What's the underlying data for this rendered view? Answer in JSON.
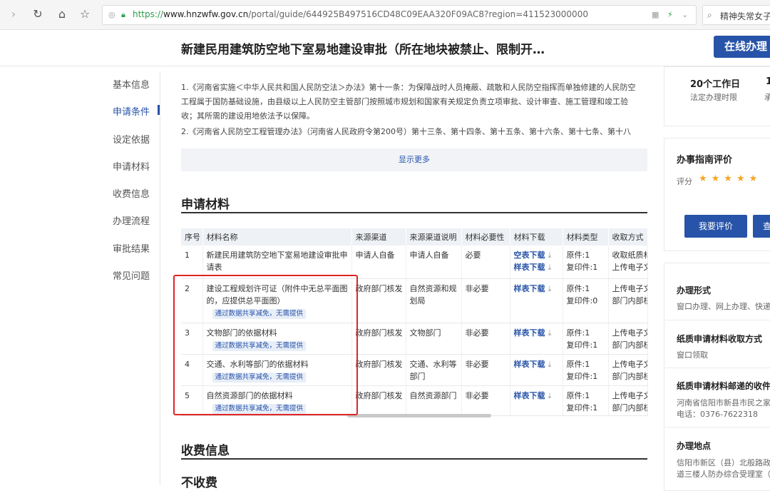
{
  "browser": {
    "url_scheme": "https://",
    "url_host": "www.hnzwfw.gov.cn",
    "url_path": "/portal/guide/644925B497516CD48C09EAA320F09AC8?region=411523000000",
    "search_text": "精神失常女子青"
  },
  "header": {
    "title": "新建民用建筑防空地下室易地建设审批（所在地块被禁止、限制开…",
    "online_button": "在线办理"
  },
  "leftnav": [
    "基本信息",
    "申请条件",
    "设定依据",
    "申请材料",
    "收费信息",
    "办理流程",
    "审批结果",
    "常见问题"
  ],
  "basis": {
    "para1_line1": "1.《河南省实施＜中华人民共和国人民防空法＞办法》第十一条：为保障战时人员掩蔽、疏散和人民防空指挥而单独修建的人民防空",
    "para1_line2": "工程属于国防基础设施，由县级以上人民防空主管部门按照城市规划和国家有关规定负责立项审批、设计审查、施工管理和竣工验",
    "para1_line3": "收；其所需的建设用地依法予以保障。",
    "para2": "2.《河南省人民防空工程管理办法》（河南省人民政府令第200号）第十三条、第十四条、第十五条、第十六条、第十七条、第十八",
    "show_more": "显示更多"
  },
  "materials": {
    "heading": "申请材料",
    "columns": [
      "序号",
      "材料名称",
      "来源渠道",
      "来源渠道说明",
      "材料必要性",
      "材料下载",
      "材料类型",
      "收取方式"
    ],
    "rows": [
      {
        "no": "1",
        "name": "新建民用建筑防空地下室易地建设审批申请表",
        "tag": "",
        "source": "申请人自备",
        "source_desc": "申请人自备",
        "need": "必要",
        "dl1": "空表下载",
        "dl2": "样表下载",
        "type1": "原件:1",
        "type2": "复印件:1",
        "collect1": "收取纸质材",
        "collect2": "上传电子文"
      },
      {
        "no": "2",
        "name": "建设工程规划许可证（附件中无总平面图的，应提供总平面图）",
        "tag": "通过数据共享减免，无需提供",
        "source": "政府部门核发",
        "source_desc": "自然资源和规划局",
        "need": "非必要",
        "dl1": "样表下载",
        "dl2": "",
        "type1": "原件:1",
        "type2": "复印件:0",
        "collect1": "上传电子文",
        "collect2": "部门内部核"
      },
      {
        "no": "3",
        "name": "文物部门的依据材料",
        "tag": "通过数据共享减免，无需提供",
        "source": "政府部门核发",
        "source_desc": "文物部门",
        "need": "非必要",
        "dl1": "样表下载",
        "dl2": "",
        "type1": "原件:1",
        "type2": "复印件:1",
        "collect1": "上传电子文",
        "collect2": "部门内部核"
      },
      {
        "no": "4",
        "name": "交通、水利等部门的依据材料",
        "tag": "通过数据共享减免，无需提供",
        "source": "政府部门核发",
        "source_desc": "交通、水利等部门",
        "need": "非必要",
        "dl1": "样表下载",
        "dl2": "",
        "type1": "原件:1",
        "type2": "复印件:1",
        "collect1": "上传电子文",
        "collect2": "部门内部核"
      },
      {
        "no": "5",
        "name": "自然资源部门的依据材料",
        "tag": "通过数据共享减免，无需提供",
        "source": "政府部门核发",
        "source_desc": "自然资源部门",
        "need": "非必要",
        "dl1": "样表下载",
        "dl2": "",
        "type1": "原件:1",
        "type2": "复印件:1",
        "collect1": "上传电子文",
        "collect2": "部门内部核"
      }
    ]
  },
  "fee": {
    "heading": "收费信息",
    "value": "不收费"
  },
  "right": {
    "days": "20个工作日",
    "days_label": "法定办理时限",
    "days2": "1",
    "days2_label": "承",
    "rating_title": "办事指南评价",
    "rating_label": "评分",
    "stars": "★★★★★",
    "eval_button": "我要评价",
    "eval_button2": "查",
    "form_title": "办理形式",
    "form_value": "窗口办理、网上办理、快递",
    "paper_title": "纸质申请材料收取方式",
    "paper_value": "窗口领取",
    "mail_title": "纸质申请材料邮递的收件",
    "mail_addr": "河南省信阳市新县市民之家",
    "mail_phone": "电话：0376-7622318",
    "place_title": "办理地点",
    "place_line1": "信阳市新区（县）北般路政",
    "place_line2": "道三楼人防办综合受理室（"
  }
}
